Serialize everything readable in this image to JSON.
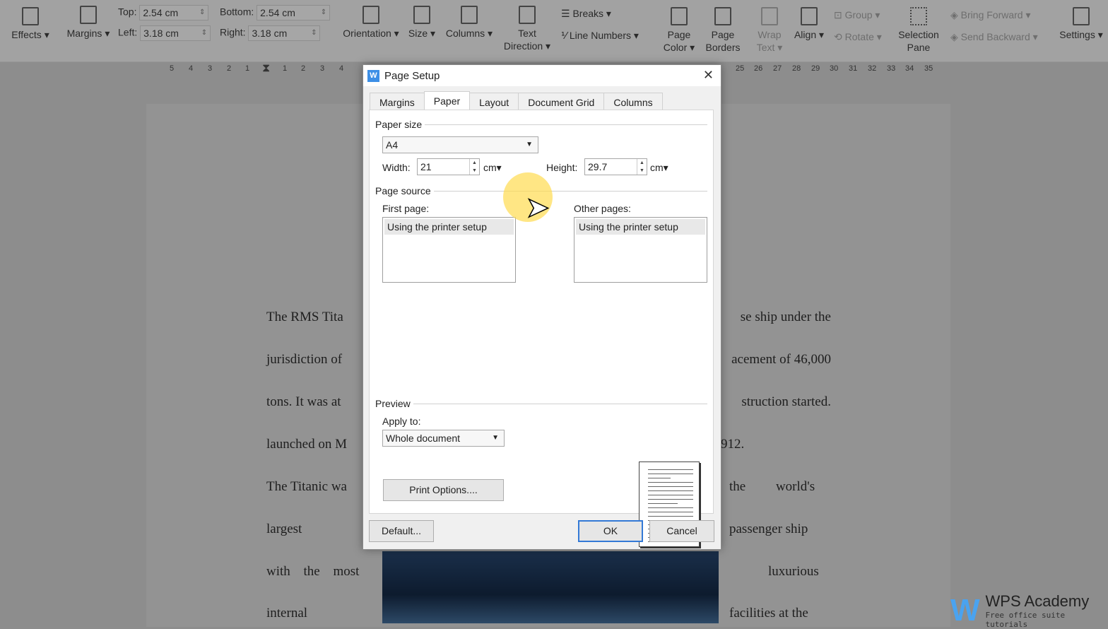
{
  "ribbon": {
    "effects": "Effects",
    "margins": "Margins",
    "top_label": "Top:",
    "top_value": "2.54 cm",
    "bottom_label": "Bottom:",
    "bottom_value": "2.54 cm",
    "left_label": "Left:",
    "left_value": "3.18 cm",
    "right_label": "Right:",
    "right_value": "3.18 cm",
    "orientation": "Orientation",
    "size": "Size",
    "columns": "Columns",
    "text_direction_1": "Text",
    "text_direction_2": "Direction",
    "breaks": "Breaks",
    "line_numbers": "Line Numbers",
    "page_color_1": "Page",
    "page_color_2": "Color",
    "page_borders_1": "Page",
    "page_borders_2": "Borders",
    "wrap_text_1": "Wrap",
    "wrap_text_2": "Text",
    "align": "Align",
    "group": "Group",
    "rotate": "Rotate",
    "selection_pane_1": "Selection",
    "selection_pane_2": "Pane",
    "bring_forward": "Bring Forward",
    "send_backward": "Send Backward",
    "settings": "Settings"
  },
  "ruler_left": [
    "5",
    "4",
    "3",
    "2",
    "1",
    "1",
    "2",
    "3",
    "4"
  ],
  "ruler_right": [
    "25",
    "26",
    "27",
    "28",
    "29",
    "30",
    "31",
    "32",
    "33",
    "34",
    "35"
  ],
  "document": {
    "left": [
      "The RMS Tita",
      "jurisdiction of",
      "tons. It was at",
      "launched on M",
      "The Titanic wa",
      "largest",
      "with the most",
      "internal"
    ],
    "right": [
      "se ship under the",
      "acement of 46,000",
      "struction started.",
      "912.",
      "the         world's",
      "passenger ship",
      "luxurious",
      "facilities at the"
    ]
  },
  "dialog": {
    "title": "Page Setup",
    "close": "✕",
    "tabs": [
      "Margins",
      "Paper",
      "Layout",
      "Document Grid",
      "Columns"
    ],
    "paper_size_group": "Paper size",
    "paper_size": "A4",
    "width_label": "Width:",
    "width_value": "21",
    "width_unit": "cm",
    "height_label": "Height:",
    "height_value": "29.7",
    "height_unit": "cm",
    "page_source_group": "Page source",
    "first_page_label": "First page:",
    "first_page_item": "Using the printer setup",
    "other_pages_label": "Other pages:",
    "other_pages_item": "Using the printer setup",
    "preview_group": "Preview",
    "apply_to_label": "Apply to:",
    "apply_to": "Whole document",
    "print_options": "Print Options....",
    "default": "Default...",
    "ok": "OK",
    "cancel": "Cancel"
  },
  "watermark": {
    "brand": "WPS Academy",
    "tagline": "Free office suite tutorials"
  }
}
